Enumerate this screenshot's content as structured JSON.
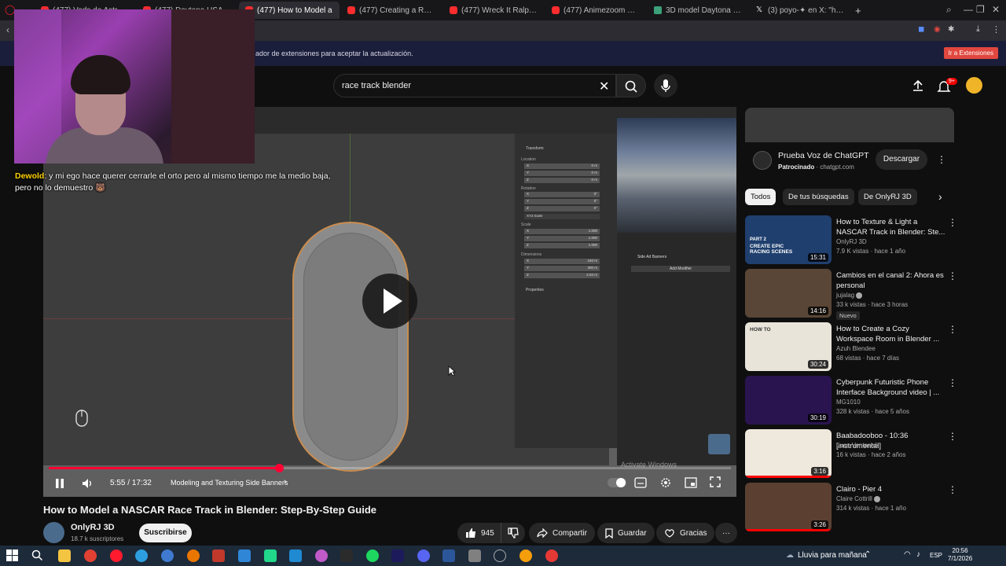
{
  "browser": {
    "tabs": [
      {
        "label": "(477) Vods de Astrobot",
        "active": false
      },
      {
        "label": "(477) Daytona USA Longplay",
        "active": false
      },
      {
        "label": "(477) How to Model a",
        "active": true
      },
      {
        "label": "(477) Creating a Race Tra",
        "active": false
      },
      {
        "label": "(477) Wreck It Ralph - Van",
        "active": false
      },
      {
        "label": "(477) Animezoom Green S",
        "active": false
      },
      {
        "label": "3D model Daytona Interna",
        "active": false
      },
      {
        "label": "(3) poyo-✦ en X: \"https://t",
        "active": false
      }
    ],
    "new_tab": "+",
    "notification": "ador de extensiones para aceptar la actualización.",
    "notification_button": "Ir a Extensiones"
  },
  "search": {
    "query": "race track blender",
    "notifications_count": "9+"
  },
  "stream": {
    "chat_user": "Dewold",
    "chat_message": ": y mi ego hace querer cerrarle el orto pero al mismo tiempo me la medio baja, pero no lo demuestro 🐻"
  },
  "player": {
    "progress": 0.3375,
    "current_time": "5:55",
    "duration": "17:32",
    "time_sep": " / ",
    "chapter": "Modeling and Texturing Side Banners",
    "watermark": "Activate Windows",
    "blender": {
      "transform": "Transform",
      "location": "Location",
      "rotation": "Rotation",
      "scale": "Scale",
      "dimensions": "Dimensions",
      "properties": "Properties",
      "euler": "XYZ Euler",
      "modifier_object": "Side Ad Banners",
      "add_modifier": "Add Modifier",
      "loc_values": [
        "0 m",
        "0 m",
        "0 m"
      ],
      "rot_values": [
        "0°",
        "0°",
        "0°"
      ],
      "scale_values": [
        "1.000",
        "1.000",
        "1.000"
      ],
      "dim_values": [
        "240 m",
        "300 m",
        "2.04 m"
      ],
      "axis_labels": [
        "X",
        "Y",
        "Z"
      ]
    }
  },
  "video": {
    "title": "How to Model a NASCAR Race Track in Blender: Step-By-Step Guide",
    "channel": "OnlyRJ 3D",
    "subscribers": "18.7 k suscriptores",
    "subscribe_label": "Suscribirse",
    "likes": "945",
    "share_label": "Compartir",
    "save_label": "Guardar",
    "thanks_label": "Gracias",
    "more_label": "···"
  },
  "ad": {
    "title": "Prueba Voz de ChatGPT",
    "sponsor_label": "Patrocinado",
    "sponsor_domain": " · chatgpt.com",
    "button": "Descargar"
  },
  "chips": [
    "Todos",
    "De tus búsquedas",
    "De OnlyRJ 3D"
  ],
  "recommendations": [
    {
      "title": "How to Texture & Light a NASCAR Track in Blender: Ste...",
      "channel": "OnlyRJ 3D",
      "meta": "7.9 K vistas · hace 1 año",
      "duration": "15:31",
      "thumb_text": "CREATE EPIC RACING SCENES",
      "thumb_sub": "PART 2",
      "color": "#1f3f6e",
      "badge": "",
      "verified": false,
      "watched": 0
    },
    {
      "title": "Cambios en el canal 2: Ahora es personal",
      "channel": "jujalag",
      "meta": "33 k vistas · hace 3 horas",
      "duration": "14:16",
      "thumb_text": "",
      "thumb_sub": "",
      "color": "#5a4636",
      "badge": "Nuevo",
      "verified": true,
      "watched": 0
    },
    {
      "title": "How to Create a Cozy Workspace Room in Blender ...",
      "channel": "Azuh Blendee",
      "meta": "68 vistas · hace 7 días",
      "duration": "30:24",
      "thumb_text": "HOW TO",
      "thumb_sub": "",
      "color": "#e9e4da",
      "badge": "",
      "verified": false,
      "watched": 0
    },
    {
      "title": "Cyberpunk Futuristic Phone Interface Background video | ...",
      "channel": "MG1010",
      "meta": "328 k vistas · hace 5 años",
      "duration": "30:19",
      "thumb_text": "",
      "thumb_sub": "",
      "color": "#2a1450",
      "badge": "",
      "verified": false,
      "watched": 0
    },
    {
      "title": "Baabadooboo - 10:36 [instrumental]",
      "channel": "Luca Ventashik",
      "meta": "16 k vistas · hace 2 años",
      "duration": "3:16",
      "thumb_text": "",
      "thumb_sub": "",
      "color": "#efe8dc",
      "badge": "",
      "verified": false,
      "watched": 1
    },
    {
      "title": "Clairo - Pier 4",
      "channel": "Claire Cottrill",
      "meta": "314 k vistas · hace 1 año",
      "duration": "3:26",
      "thumb_text": "",
      "thumb_sub": "",
      "color": "#5b4032",
      "badge": "",
      "verified": true,
      "watched": 1
    }
  ],
  "taskbar": {
    "weather": "Lluvia para mañana",
    "lang": "ESP",
    "time": "20:56",
    "date": "7/1/2026"
  }
}
